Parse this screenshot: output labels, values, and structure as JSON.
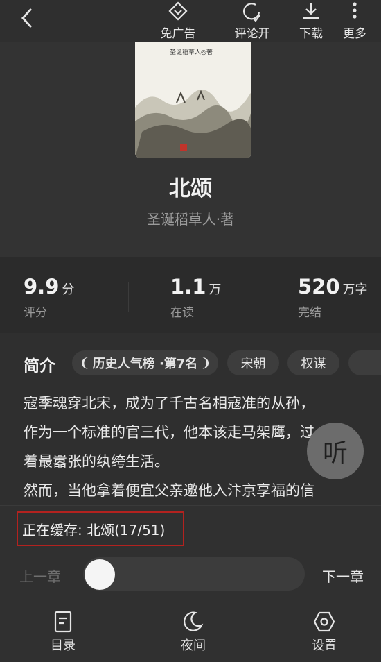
{
  "topbar": {
    "no_ads": "免广告",
    "comments": "评论开",
    "download": "下载",
    "more": "更多"
  },
  "book": {
    "cover_author": "圣诞稻草人◎著",
    "title": "北颂",
    "author": "圣诞稻草人·著"
  },
  "stats": [
    {
      "value": "9.9",
      "unit": "分",
      "label": "评分"
    },
    {
      "value": "1.1",
      "unit": "万",
      "label": "在读"
    },
    {
      "value": "520",
      "unit": "万字",
      "label": "完结"
    }
  ],
  "intro": {
    "heading": "简介",
    "tags": [
      "历史人气榜 ·第7名",
      "宋朝",
      "权谋"
    ],
    "lines": [
      "寇季魂穿北宋，成为了千古名相寇准的从孙，",
      "作为一个标准的官三代，他本该走马架鹰，过",
      "着最嚣张的纨绔生活。",
      "然而，当他拿着便宜父亲邀他入汴京享福的信"
    ]
  },
  "listen_button": "听",
  "cache_status": "正在缓存: 北颂(17/51)",
  "chapter_nav": {
    "prev": "上一章",
    "next": "下一章",
    "progress": 0.0
  },
  "bottom_nav": {
    "catalog": "目录",
    "night": "夜间",
    "settings": "设置"
  }
}
